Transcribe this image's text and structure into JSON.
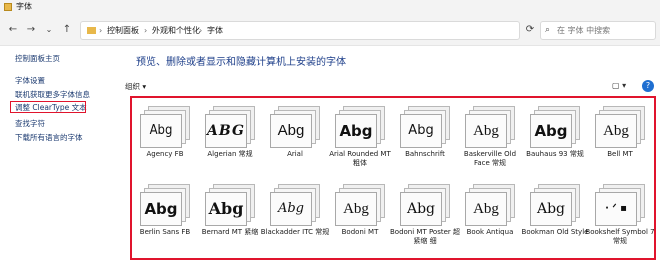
{
  "window": {
    "title": "字体"
  },
  "nav": {
    "back": "←",
    "forward": "→",
    "dropdown": "⌄",
    "up": "↑",
    "breadcrumbs": [
      "控制面板",
      "外观和个性化",
      "字体"
    ],
    "separator": "›",
    "refresh": "⟳",
    "search_placeholder": "在 字体 中搜索"
  },
  "sidebar": {
    "items": [
      "控制面板主页",
      "字体设置",
      "联机获取更多字体信息",
      "调整 ClearType 文本",
      "查找字符",
      "下载所有语言的字体"
    ],
    "highlighted_index": 3
  },
  "main": {
    "heading": "预览、删除或者显示和隐藏计算机上安装的字体",
    "organize_label": "组织 ▾",
    "view_label": "▢ ▾",
    "help_label": "?"
  },
  "fonts": [
    {
      "sample": "Abg",
      "name": "Agency FB"
    },
    {
      "sample": "ABG",
      "name": "Algerian 常规"
    },
    {
      "sample": "Abg",
      "name": "Arial"
    },
    {
      "sample": "Abg",
      "name": "Arial Rounded MT 粗体"
    },
    {
      "sample": "Abg",
      "name": "Bahnschrift"
    },
    {
      "sample": "Abg",
      "name": "Baskerville Old Face 常规"
    },
    {
      "sample": "Abg",
      "name": "Bauhaus 93 常规"
    },
    {
      "sample": "Abg",
      "name": "Bell MT"
    },
    {
      "sample": "Abg",
      "name": "Berlin Sans FB"
    },
    {
      "sample": "Abg",
      "name": "Bernard MT 紧缩"
    },
    {
      "sample": "Abg",
      "name": "Blackadder ITC 常规"
    },
    {
      "sample": "Abg",
      "name": "Bodoni MT"
    },
    {
      "sample": "Abg",
      "name": "Bodoni MT Poster 超紧缩 细"
    },
    {
      "sample": "Abg",
      "name": "Book Antiqua"
    },
    {
      "sample": "Abg",
      "name": "Bookman Old Style"
    },
    {
      "sample": "· ᐟ ▪",
      "name": "Bookshelf Symbol 7 常规"
    }
  ],
  "colors": {
    "highlight_border": "#e0142d",
    "link": "#1b3a70",
    "heading": "#1e3f8a"
  }
}
